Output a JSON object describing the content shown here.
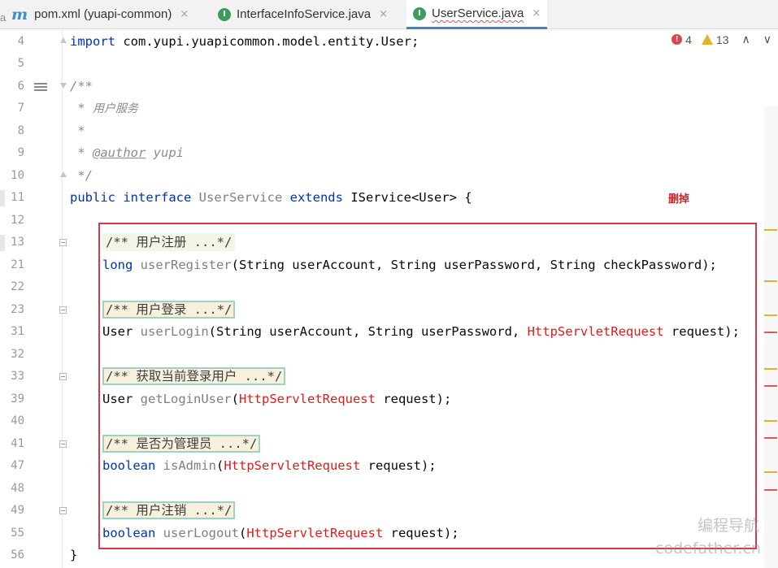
{
  "tabs": [
    {
      "icon_letter": "m",
      "label": "pom.xml (yuapi-common)",
      "close": "×"
    },
    {
      "icon_letter": "I",
      "label": "InterfaceInfoService.java",
      "close": "×"
    },
    {
      "icon_letter": "I",
      "label": "UserService.java",
      "close": "×"
    }
  ],
  "cutoff_char": "a",
  "inspections": {
    "errors": "4",
    "warnings": "13",
    "up": "∧",
    "down": "∨"
  },
  "lines": {
    "n4": "4",
    "n5": "5",
    "n6": "6",
    "n7": "7",
    "n8": "8",
    "n9": "9",
    "n10": "10",
    "n11": "11",
    "n12": "12",
    "n13": "13",
    "n21": "21",
    "n22": "22",
    "n23": "23",
    "n31": "31",
    "n32": "32",
    "n33": "33",
    "n39": "39",
    "n40": "40",
    "n41": "41",
    "n47": "47",
    "n48": "48",
    "n49": "49",
    "n55": "55",
    "n56": "56"
  },
  "code": {
    "import_kw": "import",
    "import_path": " com.yupi.yuapicommon.model.entity.User;",
    "doc_open": "/**",
    "doc_desc_star": " * ",
    "doc_desc": "用户服务",
    "doc_star": " *",
    "doc_author_star": " * ",
    "doc_author_tag": "@author",
    "doc_author_name": " yupi",
    "doc_close": " */",
    "public_kw": "public",
    "interface_kw": " interface ",
    "iface_name": "UserService",
    "extends_kw": " extends ",
    "extends_type": "IService<User> {",
    "fold_register": "/** 用户注册 ...*/",
    "register_ret": "long",
    "register_name": " userRegister",
    "register_params": "(String userAccount, String userPassword, String checkPassword);",
    "fold_login": "/** 用户登录 ...*/",
    "login_ret": "User",
    "login_name": " userLogin",
    "login_params_a": "(String userAccount, String userPassword, ",
    "login_req_type": "HttpServletRequest",
    "login_params_b": " request);",
    "fold_current": "/** 获取当前登录用户 ...*/",
    "current_ret": "User",
    "current_name": " getLoginUser",
    "current_paren": "(",
    "current_req_type": "HttpServletRequest",
    "current_rest": " request);",
    "fold_admin": "/** 是否为管理员 ...*/",
    "admin_ret": "boolean",
    "admin_name": " isAdmin",
    "admin_paren": "(",
    "admin_req_type": "HttpServletRequest",
    "admin_rest": " request);",
    "fold_logout": "/** 用户注销 ...*/",
    "logout_ret": "boolean",
    "logout_name": " userLogout",
    "logout_paren": "(",
    "logout_req_type": "HttpServletRequest",
    "logout_rest": " request);",
    "close_brace": "}"
  },
  "annotation": {
    "text": "删掉",
    "color": "#e01b1b"
  },
  "watermark": {
    "line1": "编程导航",
    "line2": "codefather.cn"
  },
  "colors": {
    "keyword": "#0033b3",
    "error_red": "#db4646",
    "warning_yellow": "#e3b12a",
    "active_tab": "#4083c9"
  }
}
